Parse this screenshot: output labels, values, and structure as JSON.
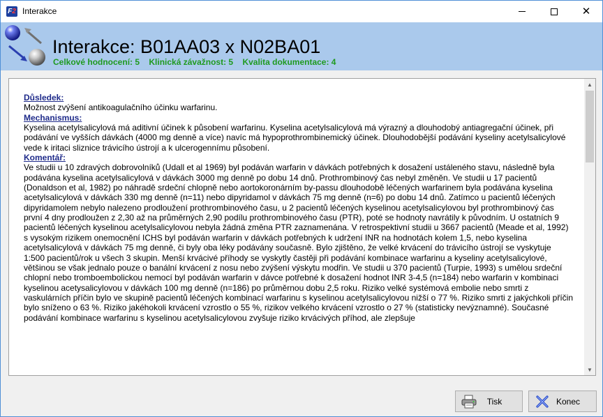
{
  "window": {
    "title": "Interakce",
    "app_icon": "F2"
  },
  "header": {
    "title": "Interakce: B01AA03 x N02BA01",
    "ratings": [
      "Celkové hodnocení: 5",
      "Klinická závažnost: 5",
      "Kvalita dokumentace: 4"
    ],
    "logo_icon": "interaction-spheres-icon"
  },
  "content": {
    "sections": [
      {
        "heading": "Důsledek:",
        "text": "Možnost zvýšení antikoagulačního účinku warfarinu."
      },
      {
        "heading": "Mechanismus:",
        "text": "Kyselina acetylsalicylová má aditivní účinek k působení warfarinu. Kyselina acetylsalicylová má výrazný a dlouhodobý antiagregační účinek, při podávání ve vyšších dávkách (4000 mg denně a více) navíc má hypoprothrombinemický účinek. Dlouhodobější podávání kyseliny acetylsalicylové vede k iritaci sliznice trávicího ústrojí a k ulcerogennímu působení."
      },
      {
        "heading": "Komentář:",
        "text": "Ve studii u 10 zdravých dobrovolníků (Udall et al 1969) byl podáván warfarin v dávkách potřebných k dosažení ustáleného stavu, následně byla podávána kyselina acetylsalicylová v dávkách 3000 mg denně po dobu 14 dnů. Prothrombinový čas nebyl změněn. Ve studii u 17 pacientů (Donaldson et al, 1982) po náhradě srdeční chlopně nebo aortokoronárním by-passu dlouhodobě léčených warfarinem byla podávána kyselina acetylsalicylová v dávkách 330 mg denně (n=11) nebo dipyridamol v dávkách 75 mg denně (n=6) po dobu 14 dnů. Zatímco u pacientů léčených dipyridamolem nebylo nalezeno prodloužení prothrombinového času, u 2 pacientů léčených kyselinou acetylsalicylovou byl prothrombinový čas první 4 dny prodloužen z 2,30 až na průměrných 2,90 podílu prothrombinového času (PTR), poté se hodnoty navrátily k původním. U ostatních 9 pacientů léčených kyselinou acetylsalicylovou nebyla žádná změna PTR zaznamenána. V retrospektivní studii u 3667 pacientů (Meade et al, 1992) s vysokým rizikem onemocnění ICHS byl podáván warfarin v dávkách potřebných k udržení INR na hodnotách kolem 1,5, nebo kyselina acetylsalicylová v dávkách 75 mg denně, či byly oba léky podávány současně. Bylo zjištěno, že velké krvácení do trávicího ústrojí se vyskytuje 1:500 pacientů/rok u všech 3 skupin. Menší krvácivé příhody se vyskytly častěji při podávání kombinace warfarinu a kyseliny acetylsalicylové, většinou se však jednalo pouze o banální krvácení z nosu nebo zvýšení výskytu modřin. Ve studii u 370 pacientů (Turpie, 1993) s umělou srdeční chlopní nebo tromboembolickou nemocí byl podáván warfarin v dávce potřebné k dosažení hodnot INR 3-4,5 (n=184) nebo warfarin v kombinaci kyselinou acetysalicylovou v dávkách 100 mg denně (n=186) po průměrnou dobu 2,5 roku. Riziko velké systémová embolie nebo smrti z vaskulárních příčin bylo ve skupině pacientů léčených kombinací warfarinu s kyselinou acetylsalicylovou nižší o 77 %. Riziko smrti z jakýchkoli příčin bylo sníženo o 63 %. Riziko jakéhokoli krvácení vzrostlo o 55 %, rizikov velkého krvácení vzrostlo o 27 % (statisticky nevýznamné). Současné podávání kombinace warfarinu s kyselinou acetylsalicylovou zvyšuje riziko krvácivých příhod, ale zlepšuje"
      }
    ]
  },
  "buttons": {
    "print_label": "Tisk",
    "print_icon": "printer-icon",
    "close_label": "Konec",
    "close_icon": "cross-icon"
  },
  "colors": {
    "header_bg": "#aac9ec",
    "rating_green": "#1f9a1f",
    "heading_navy": "#1f2b8a"
  }
}
